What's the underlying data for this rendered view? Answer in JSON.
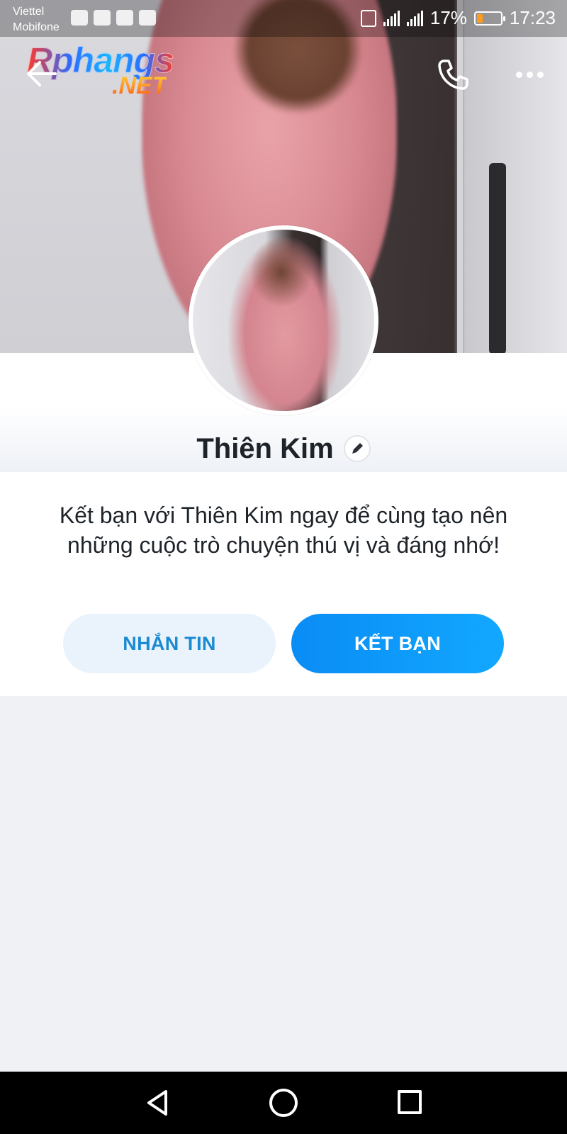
{
  "status_bar": {
    "carrier_1": "Viettel",
    "carrier_2": "Mobifone",
    "battery_percent": "17%",
    "time": "17:23",
    "battery_level": 0.17,
    "battery_color": "#ff9c1a"
  },
  "header": {
    "logo_brand": "Rphangs",
    "logo_tld": ".NET",
    "icons": [
      "back-arrow-icon",
      "phone-icon",
      "more-icon"
    ]
  },
  "profile": {
    "name": "Thiên Kim",
    "edit_icon": "pencil-icon"
  },
  "card": {
    "message": "Kết bạn với Thiên Kim ngay để cùng tạo nên những cuộc trò chuyện thú vị và đáng nhớ!",
    "message_button_label": "NHẮN TIN",
    "add_friend_button_label": "KẾT BẠN",
    "accent_color": "#0a8cf5"
  },
  "nav_bar": {
    "icons": [
      "nav-back-icon",
      "nav-home-icon",
      "nav-recents-icon"
    ]
  }
}
